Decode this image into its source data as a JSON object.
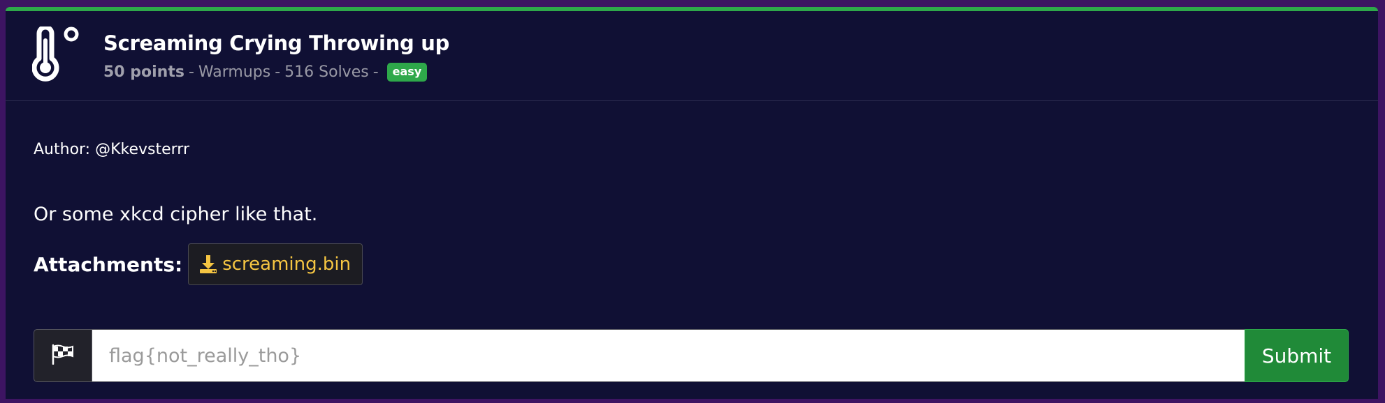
{
  "challenge": {
    "title": "Screaming Crying Throwing up",
    "points": "50 points",
    "category": "Warmups",
    "solves": "516 Solves",
    "separator": "-",
    "difficulty": "easy",
    "icon": "thermometer-icon"
  },
  "body": {
    "author": "Author: @Kkevsterrr",
    "description": "Or some xkcd cipher like that.",
    "attachments_label": "Attachments:",
    "attachments": [
      {
        "name": "screaming.bin",
        "icon": "download-icon"
      }
    ]
  },
  "flag_form": {
    "icon": "checkered-flag-icon",
    "placeholder": "flag{not_really_tho}",
    "value": "",
    "submit_label": "Submit"
  },
  "colors": {
    "accent": "#2ea84a",
    "card_bg": "#101034",
    "page_bg": "#3d1462",
    "attachment_text": "#f5c542"
  }
}
